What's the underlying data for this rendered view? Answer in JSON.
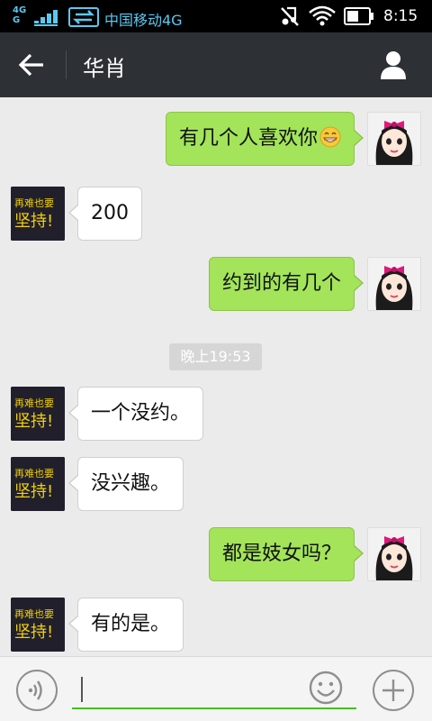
{
  "status_bar": {
    "network_top": "4G",
    "network_bottom": "G",
    "carrier": "中国移动4G",
    "time": "8:15"
  },
  "header": {
    "title": "华肖"
  },
  "messages": [
    {
      "sender": "me",
      "text": "有几个人喜欢你",
      "emoji": "grinning-face"
    },
    {
      "sender": "them",
      "text": "200",
      "avatar_text_1": "再难也要",
      "avatar_text_2": "坚持!"
    },
    {
      "sender": "me",
      "text": "约到的有几个"
    },
    {
      "type": "timestamp",
      "text": "晚上19:53"
    },
    {
      "sender": "them",
      "text": "一个没约。"
    },
    {
      "sender": "them",
      "text": "没兴趣。"
    },
    {
      "sender": "me",
      "text": "都是妓女吗？"
    },
    {
      "sender": "them",
      "text": "有的是。"
    }
  ],
  "input": {
    "value": ""
  },
  "colors": {
    "header_bg": "#2d3136",
    "my_bubble": "#a3e45a",
    "their_bubble": "#ffffff",
    "chat_bg": "#ebebeb",
    "accent": "#45c01a"
  }
}
